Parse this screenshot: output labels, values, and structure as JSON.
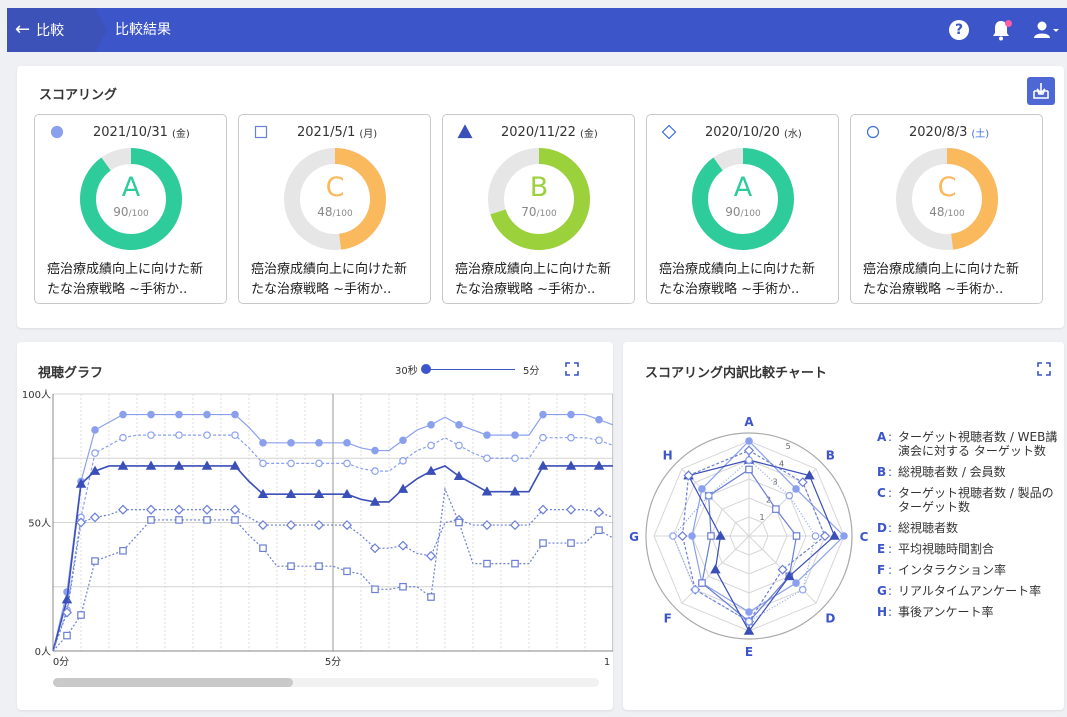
{
  "appbar": {
    "back_label": "比較",
    "title": "比較結果"
  },
  "scoring": {
    "title": "スコアリング",
    "cards": [
      {
        "marker": "circle-filled",
        "date": "2021/10/31",
        "dow": "(金)",
        "dow_color": "#333333",
        "grade": "A",
        "score": 90,
        "max": "/100",
        "score_text": "90",
        "color": "#2ecc9a",
        "desc1": "癌治療成績向上に向けた新",
        "desc2": "たな治療戦略 ~手術か.."
      },
      {
        "marker": "square-open",
        "date": "2021/5/1",
        "dow": "(月)",
        "dow_color": "#333333",
        "grade": "C",
        "score": 48,
        "max": "/100",
        "score_text": "48",
        "color": "#f9b95c",
        "desc1": "癌治療成績向上に向けた新",
        "desc2": "たな治療戦略 ~手術か.."
      },
      {
        "marker": "triangle-filled",
        "date": "2020/11/22",
        "dow": "(金)",
        "dow_color": "#333333",
        "grade": "B",
        "score": 70,
        "max": "/100",
        "score_text": "70",
        "color": "#9bd13a",
        "desc1": "癌治療成績向上に向けた新",
        "desc2": "たな治療戦略 ~手術か.."
      },
      {
        "marker": "diamond-open",
        "date": "2020/10/20",
        "dow": "(水)",
        "dow_color": "#333333",
        "grade": "A",
        "score": 90,
        "max": "/100",
        "score_text": "90",
        "color": "#2ecc9a",
        "desc1": "癌治療成績向上に向けた新",
        "desc2": "たな治療戦略 ~手術か.."
      },
      {
        "marker": "circle-open",
        "date": "2020/8/3",
        "dow": "(土)",
        "dow_color": "#3c6fe0",
        "grade": "C",
        "score": 48,
        "max": "/100",
        "score_text": "48",
        "color": "#f9b95c",
        "desc1": "癌治療成績向上に向けた新",
        "desc2": "たな治療戦略 ~手術か.."
      }
    ]
  },
  "graph": {
    "title": "視聴グラフ",
    "slider_min": "30秒",
    "slider_max": "5分",
    "slider_value": 0,
    "y_ticks": [
      "100人",
      "50人",
      "0人"
    ],
    "x_ticks": [
      "0分",
      "5分",
      "1"
    ]
  },
  "radar": {
    "title": "スコアリング内訳比較チャート",
    "rings": [
      "1",
      "2",
      "3",
      "4",
      "5"
    ],
    "axes": [
      "A",
      "B",
      "C",
      "D",
      "E",
      "F",
      "G",
      "H"
    ],
    "legend": [
      {
        "key": "A",
        "text": "ターゲット視聴者数 / WEB講演会に対する ターゲット数"
      },
      {
        "key": "B",
        "text": "総視聴者数 / 会員数"
      },
      {
        "key": "C",
        "text": "ターゲット視聴者数 / 製品のターゲット数"
      },
      {
        "key": "D",
        "text": "総視聴者数"
      },
      {
        "key": "E",
        "text": "平均視聴時間割合"
      },
      {
        "key": "F",
        "text": "インタラクション率"
      },
      {
        "key": "G",
        "text": "リアルタイムアンケート率"
      },
      {
        "key": "H",
        "text": "事後アンケート率"
      }
    ]
  },
  "chart_data": [
    {
      "type": "line",
      "title": "視聴グラフ",
      "xlabel": "",
      "ylabel": "",
      "ylim": [
        0,
        100
      ],
      "x": [
        0,
        0.25,
        0.5,
        0.75,
        1,
        1.25,
        1.5,
        1.75,
        2,
        2.25,
        2.5,
        2.75,
        3,
        3.25,
        3.5,
        3.75,
        4,
        4.25,
        4.5,
        4.75,
        5,
        5.25,
        5.5,
        5.75,
        6,
        6.25,
        6.5,
        6.75,
        7,
        7.25,
        7.5,
        7.75,
        8,
        8.25,
        8.5,
        8.75,
        9,
        9.25,
        9.5,
        9.75,
        10
      ],
      "series": [
        {
          "marker": "circle-filled",
          "color": "#8aa0ef",
          "dash": "",
          "values": [
            0,
            23,
            66,
            86,
            89,
            92,
            92,
            92,
            92,
            92,
            92,
            92,
            92,
            92,
            87,
            81,
            81,
            81,
            81,
            81,
            81,
            81,
            79,
            78,
            78,
            82,
            86,
            88,
            91,
            88,
            86,
            84,
            84,
            84,
            84,
            92,
            92,
            92,
            92,
            90,
            88
          ]
        },
        {
          "marker": "circle-open",
          "color": "#8aa0ef",
          "dash": "3,2",
          "values": [
            0,
            16,
            52,
            77,
            80,
            83,
            84,
            84,
            84,
            84,
            84,
            84,
            84,
            84,
            79,
            73,
            73,
            73,
            73,
            73,
            73,
            73,
            71,
            70,
            70,
            74,
            78,
            80,
            83,
            80,
            77,
            75,
            75,
            75,
            75,
            83,
            83,
            83,
            83,
            82,
            80
          ]
        },
        {
          "marker": "triangle-filled",
          "color": "#3b4fb8",
          "dash": "",
          "values": [
            0,
            20,
            65,
            70,
            72,
            72,
            72,
            72,
            72,
            72,
            72,
            72,
            72,
            72,
            66,
            61,
            61,
            61,
            61,
            61,
            61,
            61,
            59,
            58,
            58,
            63,
            67,
            70,
            72,
            68,
            65,
            62,
            62,
            62,
            62,
            72,
            72,
            72,
            72,
            72,
            72
          ]
        },
        {
          "marker": "diamond-open",
          "color": "#6b7fd4",
          "dash": "2,2",
          "values": [
            0,
            15,
            50,
            52,
            53,
            55,
            55,
            55,
            55,
            55,
            55,
            55,
            55,
            55,
            52,
            49,
            49,
            49,
            49,
            49,
            49,
            49,
            45,
            40,
            40,
            41,
            38,
            37,
            50,
            51,
            49,
            49,
            49,
            49,
            49,
            55,
            55,
            55,
            55,
            54,
            52
          ]
        },
        {
          "marker": "square-open",
          "color": "#6b7fd4",
          "dash": "2,2",
          "values": [
            0,
            6,
            14,
            35,
            37,
            39,
            45,
            51,
            51,
            51,
            51,
            51,
            51,
            51,
            45,
            40,
            33,
            33,
            33,
            33,
            33,
            31,
            30,
            24,
            24,
            25,
            25,
            21,
            63,
            50,
            34,
            34,
            34,
            34,
            34,
            42,
            42,
            42,
            42,
            47,
            44
          ]
        }
      ]
    },
    {
      "type": "radar",
      "title": "スコアリング内訳比較チャート",
      "axes": [
        "A",
        "B",
        "C",
        "D",
        "E",
        "F",
        "G",
        "H"
      ],
      "rmax": 5,
      "series": [
        {
          "marker": "circle-filled",
          "color": "#8aa0ef",
          "dash": "",
          "values": [
            5.0,
            3.5,
            5.0,
            3.5,
            4.0,
            3.5,
            3.0,
            3.5
          ]
        },
        {
          "marker": "square-open",
          "color": "#6b7fd4",
          "dash": "",
          "values": [
            3.5,
            2.0,
            2.5,
            3.0,
            4.5,
            3.5,
            2.0,
            3.0
          ]
        },
        {
          "marker": "triangle-filled",
          "color": "#3b4fb8",
          "dash": "",
          "values": [
            4.0,
            4.5,
            4.5,
            3.0,
            5.0,
            2.5,
            1.5,
            4.5
          ]
        },
        {
          "marker": "diamond-open",
          "color": "#6b7fd4",
          "dash": "3,2",
          "values": [
            4.5,
            4.0,
            4.0,
            2.5,
            4.5,
            4.0,
            3.5,
            4.5
          ]
        },
        {
          "marker": "circle-open",
          "color": "#8aa0ef",
          "dash": "1,2",
          "values": [
            4.0,
            3.0,
            3.5,
            4.0,
            4.5,
            4.0,
            4.0,
            3.0
          ]
        }
      ]
    }
  ]
}
